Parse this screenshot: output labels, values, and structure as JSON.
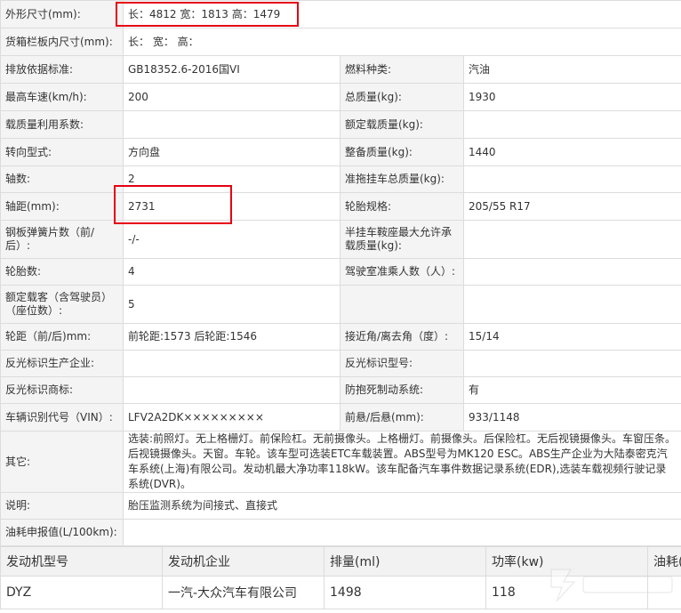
{
  "spec_rows": [
    {
      "label": "外形尺寸(mm):",
      "value": "长：4812 宽：1813 高：1479"
    },
    {
      "label": "货箱栏板内尺寸(mm):",
      "value": "长： 宽： 高："
    },
    {
      "l1": "排放依据标准:",
      "v1": "GB18352.6-2016国VI",
      "l2": "燃料种类:",
      "v2": "汽油"
    },
    {
      "l1": "最高车速(km/h):",
      "v1": "200",
      "l2": "总质量(kg):",
      "v2": "1930"
    },
    {
      "l1": "载质量利用系数:",
      "v1": "",
      "l2": "额定载质量(kg):",
      "v2": ""
    },
    {
      "l1": "转向型式:",
      "v1": "方向盘",
      "l2": "整备质量(kg):",
      "v2": "1440"
    },
    {
      "l1": "轴数:",
      "v1": "2",
      "l2": "准拖挂车总质量(kg):",
      "v2": ""
    },
    {
      "l1": "轴距(mm):",
      "v1": "2731",
      "l2": "轮胎规格:",
      "v2": "205/55 R17"
    },
    {
      "l1": "钢板弹簧片数（前/后）:",
      "v1": "-/-",
      "l2": "半挂车鞍座最大允许承载质量(kg):",
      "v2": ""
    },
    {
      "l1": "轮胎数:",
      "v1": "4",
      "l2": "驾驶室准乘人数（人）:",
      "v2": ""
    },
    {
      "l1": "额定载客（含驾驶员）（座位数）:",
      "v1": "5",
      "l2": "",
      "v2": ""
    },
    {
      "l1": "轮距（前/后)mm:",
      "v1": "前轮距:1573 后轮距:1546",
      "l2": "接近角/离去角（度）:",
      "v2": "15/14"
    },
    {
      "l1": "反光标识生产企业:",
      "v1": "",
      "l2": "反光标识型号:",
      "v2": ""
    },
    {
      "l1": "反光标识商标:",
      "v1": "",
      "l2": "防抱死制动系统:",
      "v2": "有"
    },
    {
      "l1": "车辆识别代号（VIN）:",
      "v1": "LFV2A2DK×××××××××",
      "l2": "前悬/后悬(mm):",
      "v2": "933/1148"
    },
    {
      "label": "其它:",
      "value": "选装:前照灯。无上格栅灯。前保险杠。无前摄像头。上格栅灯。前摄像头。后保险杠。无后视镜摄像头。车窗压条。后视镜摄像头。天窗。车轮。该车型可选装ETC车载装置。ABS型号为MK120 ESC。ABS生产企业为大陆泰密克汽车系统(上海)有限公司。发动机最大净功率118kW。该车配备汽车事件数据记录系统(EDR),选装车载视频行驶记录系统(DVR)。"
    },
    {
      "label": "说明:",
      "value": "胎压监测系统为间接式、直接式"
    },
    {
      "label": "油耗申报值(L/100km):",
      "value": ""
    }
  ],
  "engine_table": {
    "headers": [
      "发动机型号",
      "发动机企业",
      "排量(ml)",
      "功率(kw)",
      "油耗(L"
    ],
    "row": [
      "DYZ",
      "一汽-大众汽车有限公司",
      "1498",
      "118",
      ""
    ]
  },
  "highlight_color": "#e50012"
}
